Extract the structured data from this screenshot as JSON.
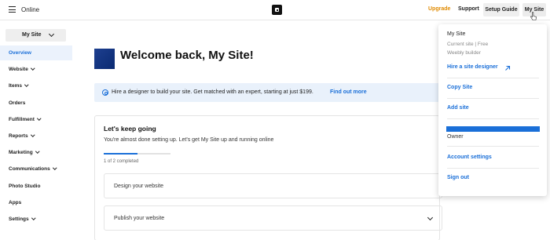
{
  "topbar": {
    "app_name": "Online",
    "links": {
      "upgrade": "Upgrade",
      "support": "Support",
      "setup_guide": "Setup Guide",
      "my_site": "My Site"
    },
    "accent_upgrade": "#e08a00"
  },
  "sidebar": {
    "site_selector": "My Site",
    "items": [
      {
        "label": "Overview",
        "active": true,
        "has_children": false
      },
      {
        "label": "Website",
        "has_children": true
      },
      {
        "label": "Items",
        "has_children": true
      },
      {
        "label": "Orders",
        "has_children": false
      },
      {
        "label": "Fulfillment",
        "has_children": true
      },
      {
        "label": "Reports",
        "has_children": true
      },
      {
        "label": "Marketing",
        "has_children": true
      },
      {
        "label": "Communications",
        "has_children": true
      },
      {
        "label": "Photo Studio",
        "has_children": false
      },
      {
        "label": "Apps",
        "has_children": false
      },
      {
        "label": "Settings",
        "has_children": true
      }
    ]
  },
  "main": {
    "welcome_title": "Welcome back, My Site!",
    "banner": {
      "text": "Hire a designer to build your site. Get matched with an expert, starting at just $199.",
      "link": "Find out more"
    },
    "card": {
      "title": "Let's keep going",
      "subtitle": "You're almost done setting up. Let's get My Site up and running online",
      "progress_fraction": 0.5,
      "progress_label": "1 of 2 completed",
      "tasks": [
        {
          "label": "Design your website"
        },
        {
          "label": "Publish your website"
        }
      ]
    }
  },
  "dropdown": {
    "site_name": "My Site",
    "site_status": "Current site  |  Free",
    "builder": "Weebly builder",
    "hire_designer": "Hire a site designer",
    "copy_site": "Copy Site",
    "add_site": "Add site",
    "role": "Owner",
    "account_settings": "Account settings",
    "sign_out": "Sign out"
  },
  "colors": {
    "accent": "#1a6fd8",
    "active_bg": "#ebf2fc",
    "banner_bg": "#e9f1fb"
  }
}
